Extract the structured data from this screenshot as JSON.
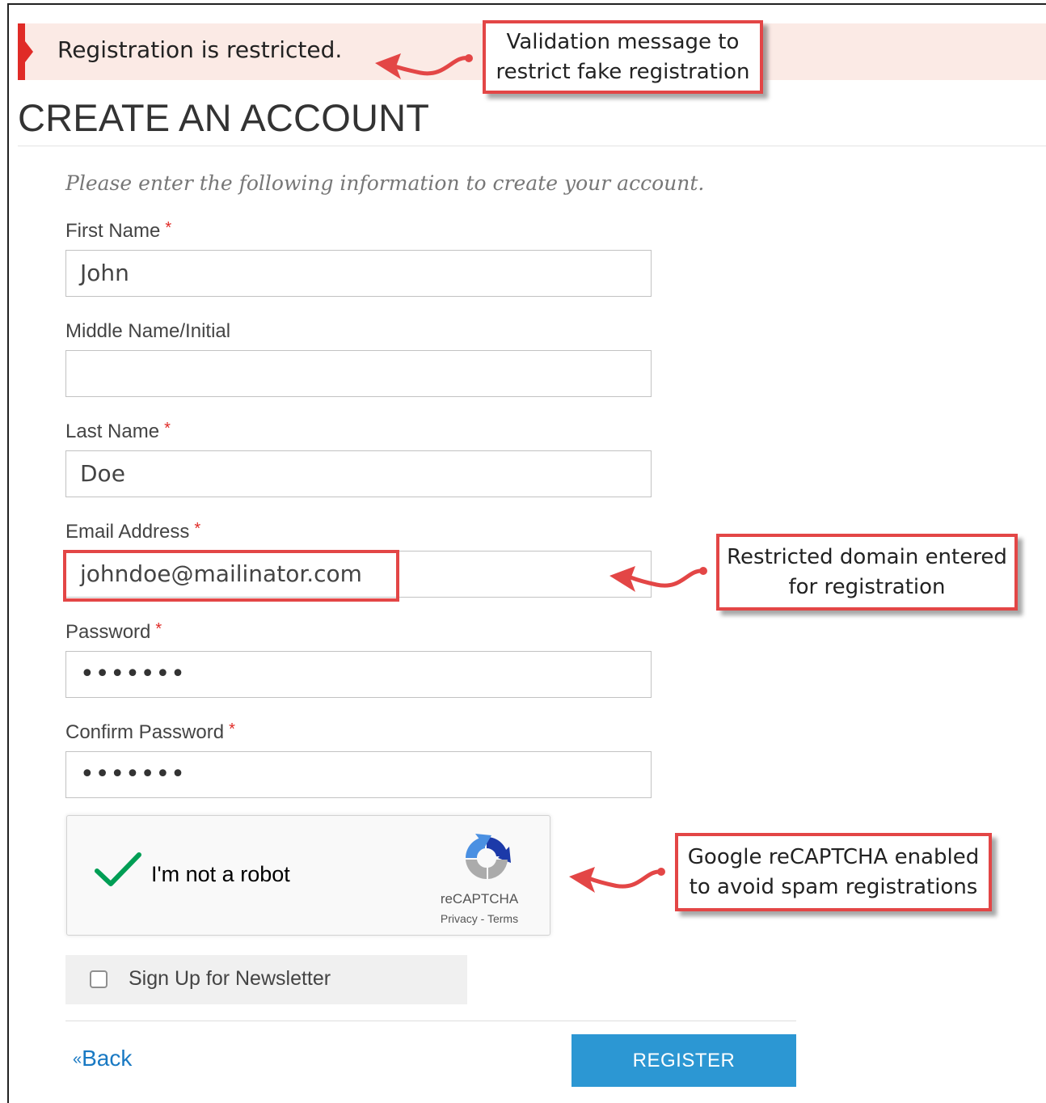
{
  "error": {
    "message": "Registration is restricted."
  },
  "annotations": {
    "validation": "Validation message to\nrestrict fake registration",
    "domain": "Restricted domain entered\nfor registration",
    "captcha": "Google reCAPTCHA enabled\nto avoid spam registrations",
    "arrow_color": "#e34646"
  },
  "page": {
    "title": "CREATE AN ACCOUNT",
    "intro": "Please enter the following information to create your account."
  },
  "form": {
    "required_marker": "*",
    "first_name": {
      "label": "First Name",
      "value": "John"
    },
    "middle_name": {
      "label": "Middle Name/Initial",
      "value": ""
    },
    "last_name": {
      "label": "Last Name",
      "value": "Doe"
    },
    "email": {
      "label": "Email Address",
      "value": "johndoe@mailinator.com"
    },
    "password": {
      "label": "Password",
      "value": "•••••••"
    },
    "confirm_password": {
      "label": "Confirm Password",
      "value": "•••••••"
    }
  },
  "recaptcha": {
    "label": "I'm not a robot",
    "brand": "reCAPTCHA",
    "links": "Privacy - Terms",
    "checked": true
  },
  "newsletter": {
    "label": "Sign Up for Newsletter",
    "checked": false
  },
  "actions": {
    "back_symbol": "«",
    "back_label": "Back",
    "register_label": "REGISTER"
  },
  "colors": {
    "accent_blue": "#2c97d3",
    "link_blue": "#1979c3",
    "error_red": "#e02b27",
    "error_bg": "#fbeae5",
    "check_green": "#009e55"
  }
}
